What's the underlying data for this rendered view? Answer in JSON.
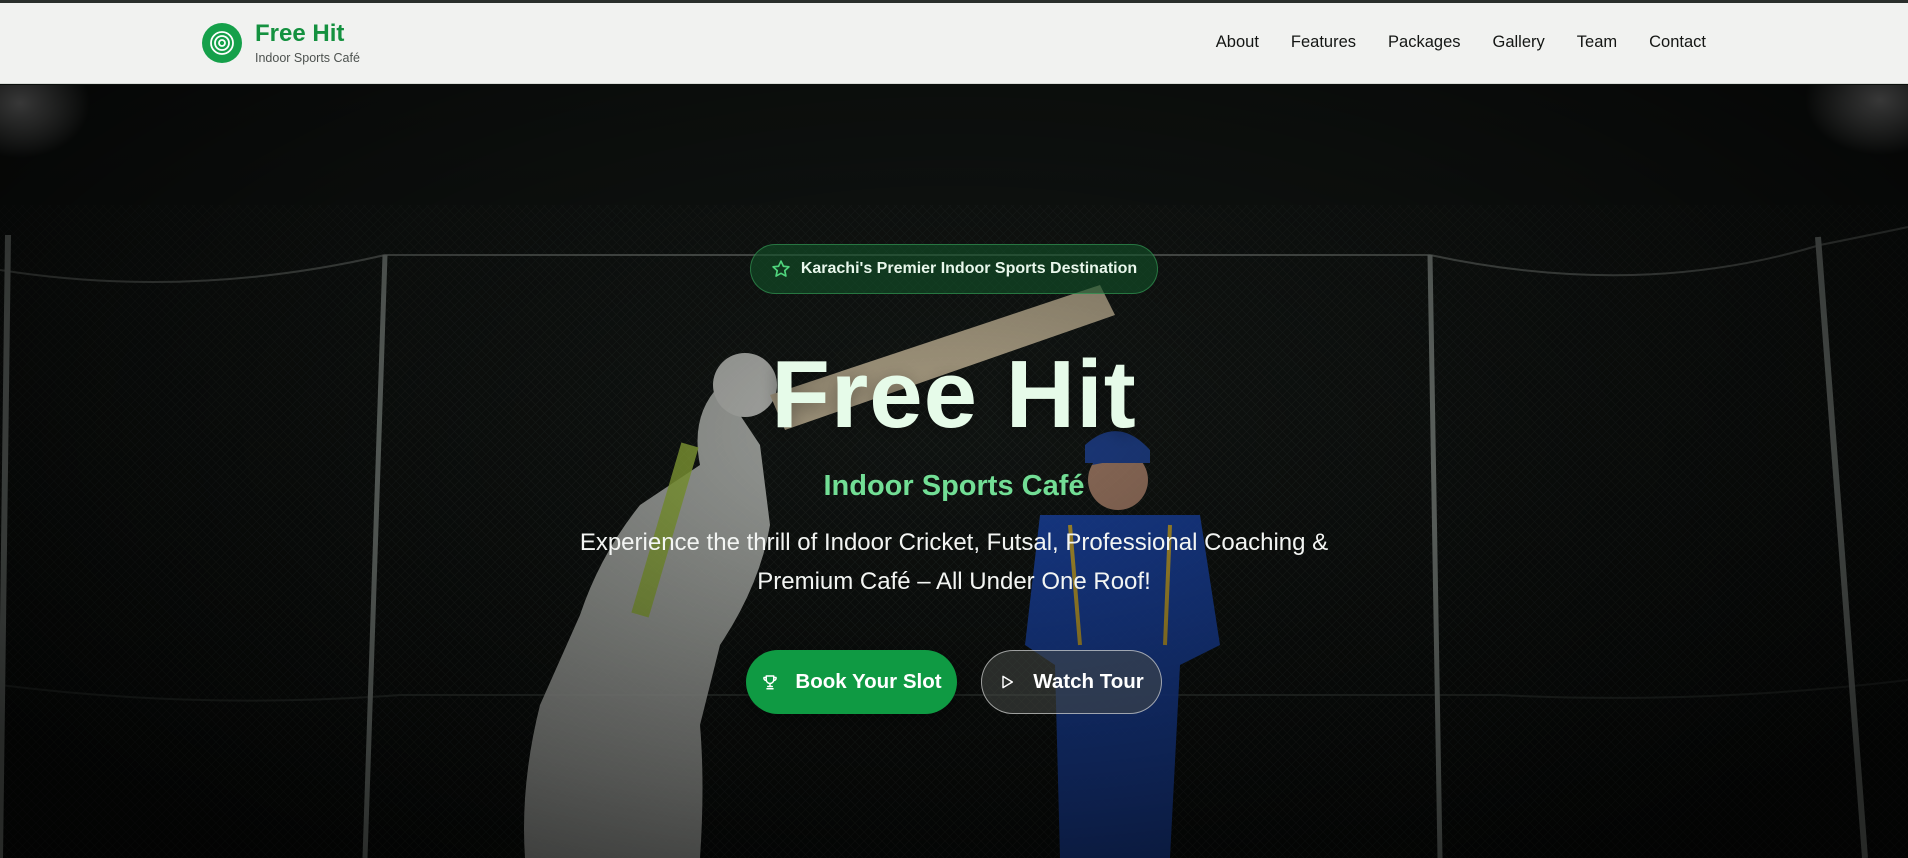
{
  "brand": {
    "name": "Free Hit",
    "tagline": "Indoor Sports Café",
    "logo_icon": "target-icon",
    "color": "#14913f"
  },
  "nav": {
    "items": [
      {
        "label": "About"
      },
      {
        "label": "Features"
      },
      {
        "label": "Packages"
      },
      {
        "label": "Gallery"
      },
      {
        "label": "Team"
      },
      {
        "label": "Contact"
      }
    ]
  },
  "hero": {
    "badge": {
      "icon": "star-icon",
      "text": "Karachi's Premier Indoor Sports Destination"
    },
    "title": "Free Hit",
    "subtitle": "Indoor Sports Café",
    "description": "Experience the thrill of Indoor Cricket, Futsal, Professional Coaching & Premium Café – All Under One Roof!",
    "primary_button": {
      "label": "Book Your Slot",
      "icon": "trophy-icon",
      "color": "#0f9a43"
    },
    "secondary_button": {
      "label": "Watch Tour",
      "icon": "play-icon"
    }
  }
}
